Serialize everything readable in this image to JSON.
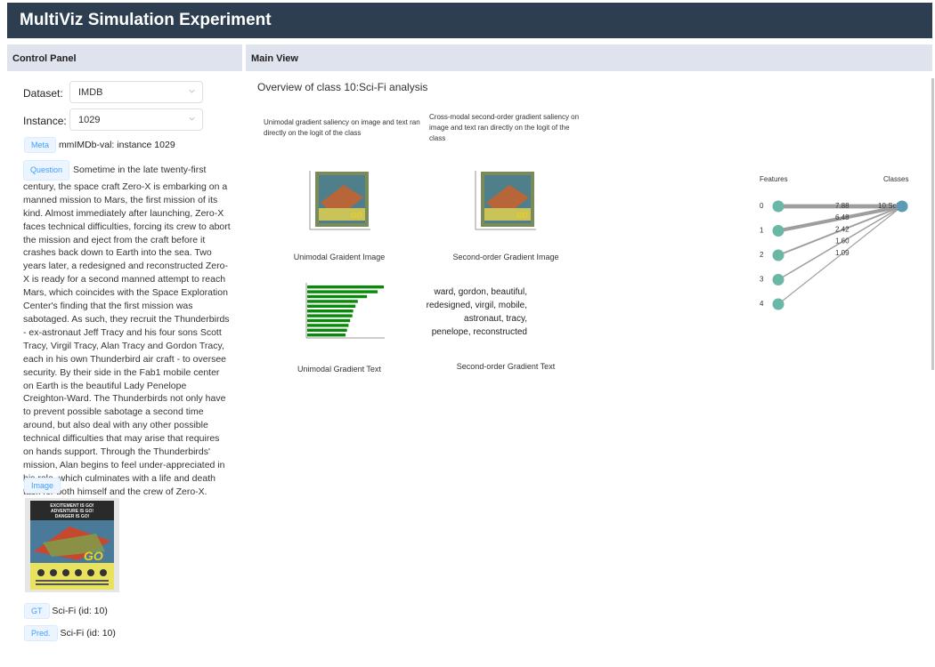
{
  "app": {
    "title": "MultiViz Simulation Experiment"
  },
  "control_panel": {
    "header": "Control Panel",
    "dataset_label": "Dataset:",
    "dataset_value": "IMDB",
    "instance_label": "Instance:",
    "instance_value": "1029",
    "meta_tag": "Meta",
    "meta_text": "mmIMDb-val: instance 1029",
    "question_tag": "Question",
    "question_text": "Sometime in the late twenty-first century, the space craft Zero-X is embarking on a manned mission to Mars, the first mission of its kind. Almost immediately after launching, Zero-X faces technical difficulties, forcing its crew to abort the mission and eject from the craft before it crashes back down to Earth into the sea. Two years later, a redesigned and reconstructed Zero-X is ready for a second manned attempt to reach Mars, which coincides with the Space Exploration Center's finding that the first mission was sabotaged. As such, they recruit the Thunderbirds - ex-astronaut Jeff Tracy and his four sons Scott Tracy, Virgil Tracy, Alan Tracy and Gordon Tracy, each in his own Thunderbird air craft - to oversee security. By their side in the Fab1 mobile center on Earth is the beautiful Lady Penelope Creighton-Ward. The Thunderbirds not only have to prevent possible sabotage a second time around, but also deal with any other possible technical difficulties that may arise that requires on hands support. Through the Thunderbirds' mission, Alan begins to feel under-appreciated in his role, which culminates with a life and death task for both himself and the crew of Zero-X.",
    "image_tag": "Image",
    "poster_text": {
      "line1": "EXCITEMENT IS GO!",
      "line2": "ADVENTURE IS GO!",
      "line3": "DANGER IS GO!",
      "logo": "GO"
    },
    "gt_tag": "GT",
    "gt_text": "Sci-Fi (id: 10)",
    "pred_tag": "Pred.",
    "pred_text": "Sci-Fi (id: 10)"
  },
  "main_view": {
    "header": "Main View",
    "overview_title": "Overview of class 10:Sci-Fi analysis",
    "unimodal_desc": "Unimodal gradient saliency on image and text ran directly on the logit of the class",
    "crossmodal_desc": "Cross-modal second-order gradient saliency on image and text ran directly on the logit of the class",
    "unimodal_image_caption": "Unimodal Graident Image",
    "second_order_image_caption": "Second-order Gradient Image",
    "unimodal_text_caption": "Unimodal Gradient Text",
    "second_order_text_caption": "Second-order Gradient Text",
    "second_order_words": "ward, gordon, beautiful, redesigned, virgil, mobile, astronaut, tracy, penelope, reconstructed"
  },
  "chart_data": {
    "type": "bar",
    "orientation": "horizontal",
    "values": [
      1.0,
      0.92,
      0.78,
      0.66,
      0.63,
      0.6,
      0.59,
      0.56,
      0.54,
      0.52,
      0.5
    ],
    "bar_color": "#0a8a0a"
  },
  "graph": {
    "features_label": "Features",
    "classes_label": "Classes",
    "class_node_label": "10:Sci-Fi",
    "feature_nodes": [
      "0",
      "1",
      "2",
      "3",
      "4"
    ],
    "edge_weights": [
      "7.88",
      "6.48",
      "2.42",
      "1.60",
      "1.09"
    ],
    "node_color": "#6ab7a6",
    "class_node_color": "#5b9bb5",
    "edge_color": "#9e9e9e"
  },
  "colors": {
    "topbar": "#2c3e50",
    "panel_header": "#dfe3ee",
    "tag_bg": "#ecf5ff",
    "tag_text": "#409eff"
  }
}
